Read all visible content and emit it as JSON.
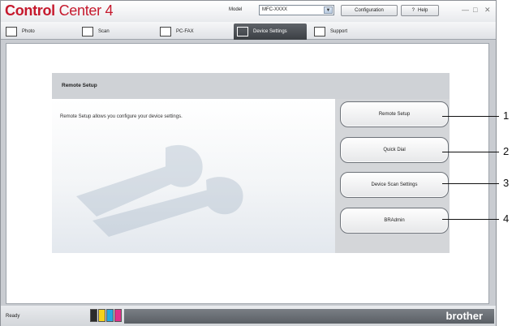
{
  "titlebar": {
    "logo_part1": "Control",
    "logo_part2": " Center 4",
    "model_label": "Model",
    "model_value": "MFC-XXXX",
    "configuration_label": "Configuration",
    "help_label": "Help",
    "help_icon": "?"
  },
  "tabs": [
    {
      "label": "Photo",
      "icon": "photo-icon"
    },
    {
      "label": "Scan",
      "icon": "scanner-icon"
    },
    {
      "label": "PC-FAX",
      "icon": "fax-icon"
    },
    {
      "label": "Device Settings",
      "icon": "device-settings-icon",
      "active": true
    },
    {
      "label": "Support",
      "icon": "support-icon"
    }
  ],
  "panel": {
    "title": "Remote Setup",
    "description": "Remote Setup allows you configure your device settings."
  },
  "actions": [
    {
      "label": "Remote Setup",
      "callout": "1"
    },
    {
      "label": "Quick Dial",
      "callout": "2"
    },
    {
      "label": "Device Scan Settings",
      "callout": "3"
    },
    {
      "label": "BRAdmin",
      "callout": "4"
    }
  ],
  "status": {
    "text": "Ready",
    "brand": "brother",
    "ink_colors": [
      "#2b2b2b",
      "#f4d21c",
      "#26a8e0",
      "#e0318a"
    ]
  }
}
